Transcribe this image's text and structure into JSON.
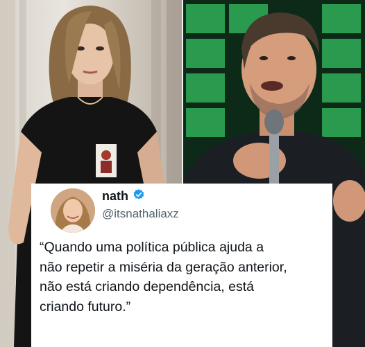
{
  "tweet": {
    "name": "nath",
    "handle": "@itsnathaliaxz",
    "text_lines": [
      "“Quando uma política pública ajuda a",
      "não repetir a miséria da geração anterior,",
      "não está criando dependência, está",
      "criando futuro.”"
    ]
  },
  "icons": {
    "verified": "verified-badge-icon"
  },
  "colors": {
    "verified_blue": "#1d9bf0",
    "text_primary": "#0f1419",
    "text_secondary": "#536471",
    "stage_green": "#2fae58"
  }
}
